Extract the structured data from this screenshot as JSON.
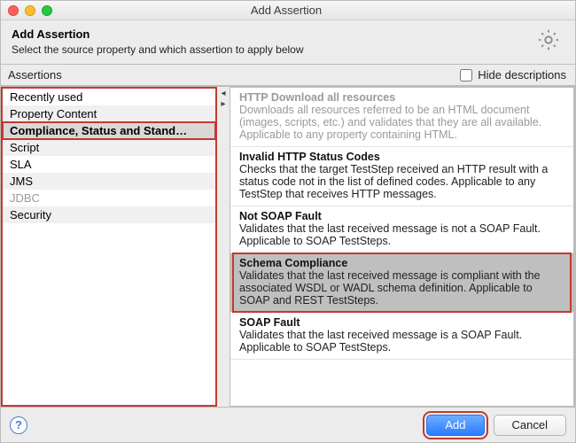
{
  "window": {
    "title": "Add Assertion"
  },
  "header": {
    "title": "Add Assertion",
    "subtitle": "Select the source property and which assertion to apply below"
  },
  "toolbar": {
    "section_label": "Assertions",
    "hide_descriptions_label": "Hide descriptions",
    "hide_descriptions_checked": false
  },
  "categories": {
    "items": [
      {
        "label": "Recently used",
        "state": "normal"
      },
      {
        "label": "Property Content",
        "state": "normal"
      },
      {
        "label": "Compliance, Status and Stand…",
        "state": "selected"
      },
      {
        "label": "Script",
        "state": "normal"
      },
      {
        "label": "SLA",
        "state": "normal"
      },
      {
        "label": "JMS",
        "state": "normal"
      },
      {
        "label": "JDBC",
        "state": "disabled"
      },
      {
        "label": "Security",
        "state": "normal"
      }
    ]
  },
  "assertions": {
    "items": [
      {
        "name": "HTTP Download all resources",
        "desc": "Downloads all resources referred to be an HTML document (images, scripts, etc.) and validates that they are all available. Applicable to any property containing HTML.",
        "state": "disabled"
      },
      {
        "name": "Invalid HTTP Status Codes",
        "desc": "Checks that the target TestStep received an HTTP result with a status code not in the list of defined codes. Applicable to any TestStep that receives HTTP messages.",
        "state": "normal"
      },
      {
        "name": "Not SOAP Fault",
        "desc": "Validates that the last received message is not a SOAP Fault. Applicable to SOAP TestSteps.",
        "state": "normal"
      },
      {
        "name": "Schema Compliance",
        "desc": "Validates that the last received message is compliant with the associated WSDL or WADL schema definition. Applicable to SOAP and REST TestSteps.",
        "state": "selected"
      },
      {
        "name": "SOAP Fault",
        "desc": "Validates that the last received message is a SOAP Fault. Applicable to SOAP TestSteps.",
        "state": "normal"
      }
    ]
  },
  "footer": {
    "add_label": "Add",
    "cancel_label": "Cancel"
  }
}
